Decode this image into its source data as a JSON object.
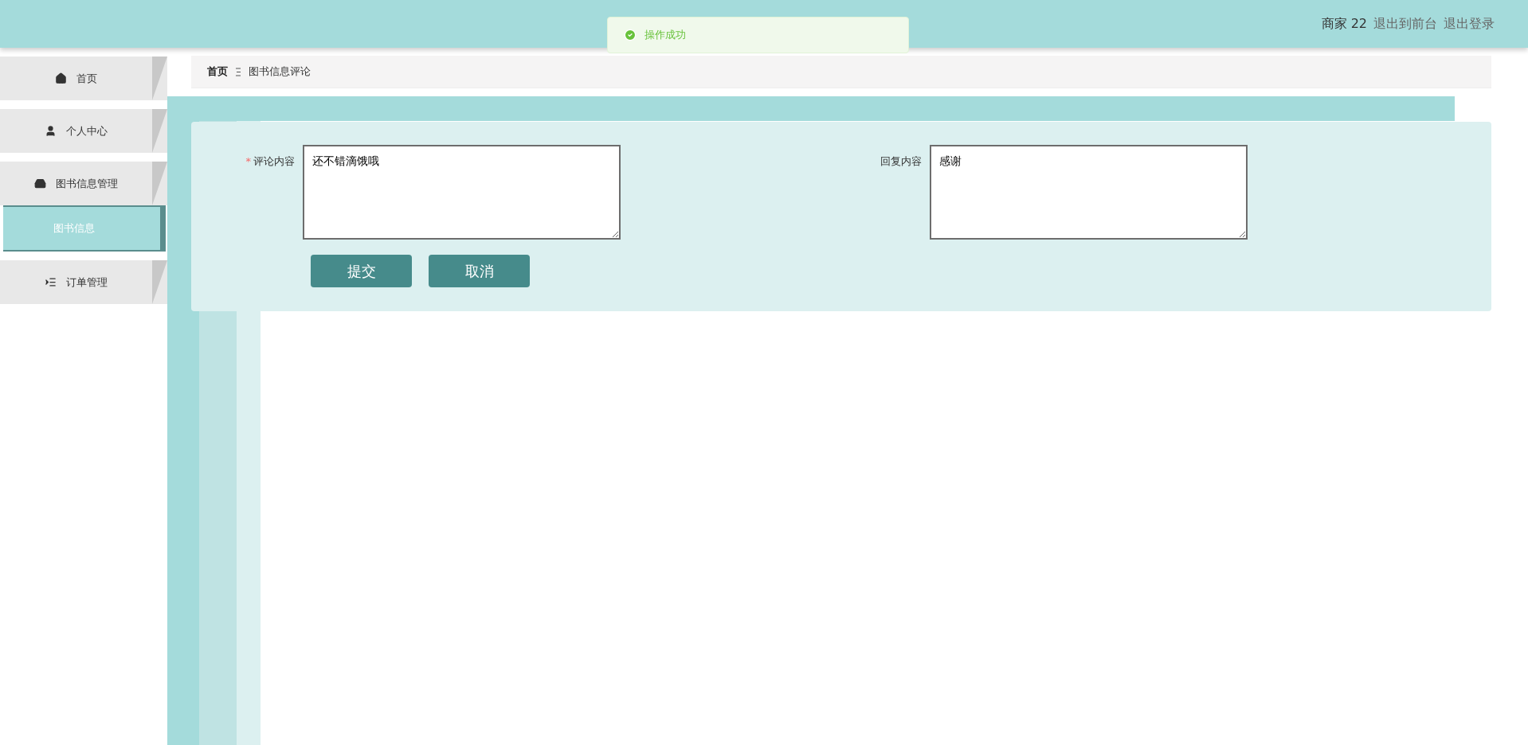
{
  "header": {
    "user": "商家 22",
    "links": [
      "退出到前台",
      "退出登录"
    ]
  },
  "toast": {
    "kind": "success",
    "message": "操作成功"
  },
  "sidebar": {
    "items": [
      {
        "label": "首页",
        "kind": "home"
      },
      {
        "label": "个人中心",
        "kind": "user"
      },
      {
        "label": "图书信息管理",
        "kind": "book",
        "children": [
          {
            "label": "图书信息",
            "selected": true
          }
        ]
      },
      {
        "label": "订单管理",
        "kind": "list"
      }
    ]
  },
  "breadcrumb": {
    "home": "首页",
    "current": "图书信息评论"
  },
  "form": {
    "fields": [
      {
        "label": "评论内容",
        "required_mark": "*",
        "value": "还不错滴饿哦"
      },
      {
        "label": "回复内容",
        "value": "感谢"
      }
    ],
    "buttons": [
      "提交",
      "取消"
    ]
  }
}
